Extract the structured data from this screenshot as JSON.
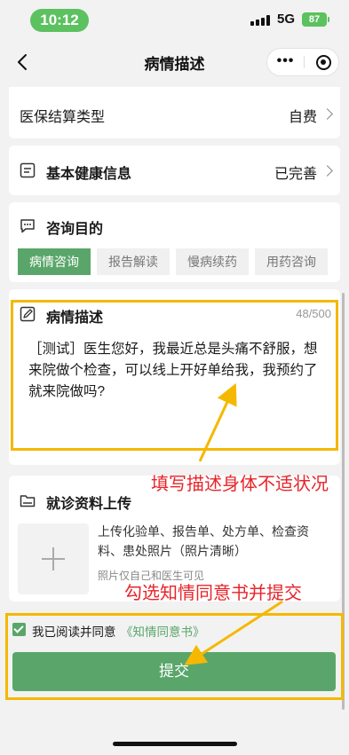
{
  "status_bar": {
    "time": "10:12",
    "network": "5G",
    "battery": "87"
  },
  "nav": {
    "title": "病情描述",
    "more_glyph": "•••"
  },
  "settlement": {
    "label": "医保结算类型",
    "value": "自费"
  },
  "health_info": {
    "title": "基本健康信息",
    "value": "已完善"
  },
  "purpose": {
    "title": "咨询目的",
    "tags": [
      {
        "label": "病情咨询",
        "active": true
      },
      {
        "label": "报告解读",
        "active": false
      },
      {
        "label": "慢病续药",
        "active": false
      },
      {
        "label": "用药咨询",
        "active": false
      }
    ]
  },
  "description": {
    "title": "病情描述",
    "counter": "48/500",
    "text": "［测试］医生您好，我最近总是头痛不舒服，想来院做个检查，可以线上开好单给我，我预约了就来院做吗?"
  },
  "upload": {
    "title": "就诊资料上传",
    "hint": "上传化验单、报告单、处方单、检查资料、患处照片（照片清晰）",
    "sub_hint": "照片仅自己和医生可见"
  },
  "agreement": {
    "checked": true,
    "text": "我已阅读并同意",
    "link": "《知情同意书》"
  },
  "submit_label": "提交",
  "annotations": {
    "describe": "填写描述身体不适状况",
    "consent": "勾选知情同意书并提交"
  },
  "colors": {
    "accent": "#5aa66a",
    "highlight": "#f5b800",
    "annotation": "#e8242a"
  },
  "icons": [
    "chevron-left-icon",
    "more-icon",
    "target-icon",
    "document-icon",
    "chat-icon",
    "edit-icon",
    "folder-icon",
    "plus-icon",
    "check-icon",
    "chevron-right-icon"
  ]
}
